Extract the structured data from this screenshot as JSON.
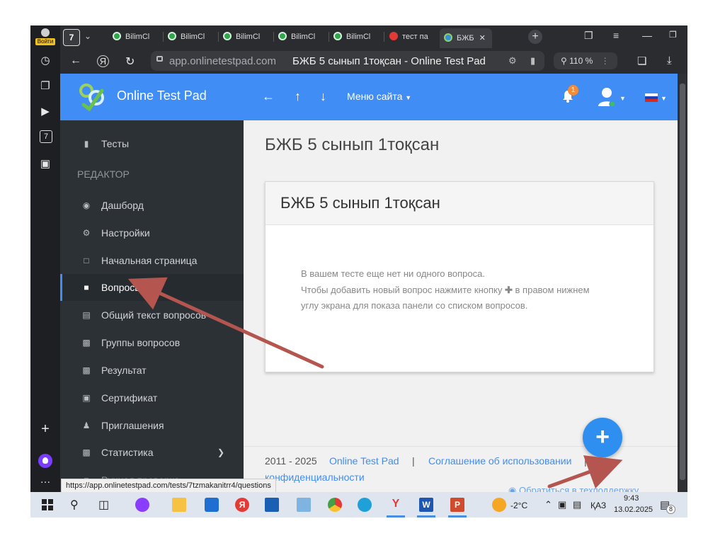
{
  "browser": {
    "login_label": "Войти",
    "tab_count": "7",
    "tabs": [
      {
        "label": "BilimCl"
      },
      {
        "label": "BilimCl"
      },
      {
        "label": "BilimCl"
      },
      {
        "label": "BilimCl"
      },
      {
        "label": "BilimCl"
      },
      {
        "label": "тест па"
      },
      {
        "label": "БЖБ"
      }
    ],
    "url": "app.onlinetestpad.com",
    "page_title": "БЖБ 5 сынып 1тоқсан - Online Test Pad",
    "zoom": "110 %",
    "status_url": "https://app.onlinetestpad.com/tests/7tzmakanitrr4/questions"
  },
  "site": {
    "brand": "Online Test Pad",
    "menu_label": "Меню сайта",
    "notification_count": "1",
    "sidebar": {
      "top_item": "Тесты",
      "section_heading": "РЕДАКТОР",
      "items": [
        {
          "label": "Дашборд"
        },
        {
          "label": "Настройки"
        },
        {
          "label": "Начальная страница"
        },
        {
          "label": "Вопросы"
        },
        {
          "label": "Общий текст вопросов"
        },
        {
          "label": "Группы вопросов"
        },
        {
          "label": "Результат"
        },
        {
          "label": "Сертификат"
        },
        {
          "label": "Приглашения"
        },
        {
          "label": "Статистика"
        },
        {
          "label": "Ручная проверка"
        }
      ]
    },
    "main": {
      "page_title": "БЖБ 5 сынып 1тоқсан",
      "card_title": "БЖБ 5 сынып 1тоқсан",
      "message_line1": "В вашем тесте еще нет ни одного вопроса.",
      "message_line2_a": "Чтобы добавить новый вопрос нажмите кнопку",
      "message_line2_b": "в правом нижнем",
      "message_line3": "углу экрана для показа панели со списком вопросов."
    },
    "footer": {
      "years": "2011 - 2025",
      "brand_link": "Online Test Pad",
      "separator": "|",
      "agreement": "Соглашение об использовании",
      "privacy_start": "П",
      "privacy_end": "конфиденциальности",
      "support": "Обратиться в техподдержку"
    }
  },
  "taskbar": {
    "weather": "-2°C",
    "language": "ҚАЗ",
    "time": "9:43",
    "date": "13.02.2025",
    "notifications": "8"
  },
  "colors": {
    "header_blue": "#3f8df5",
    "sidebar_dark": "#2c3136",
    "annotation_arrow": "#b5554f"
  }
}
